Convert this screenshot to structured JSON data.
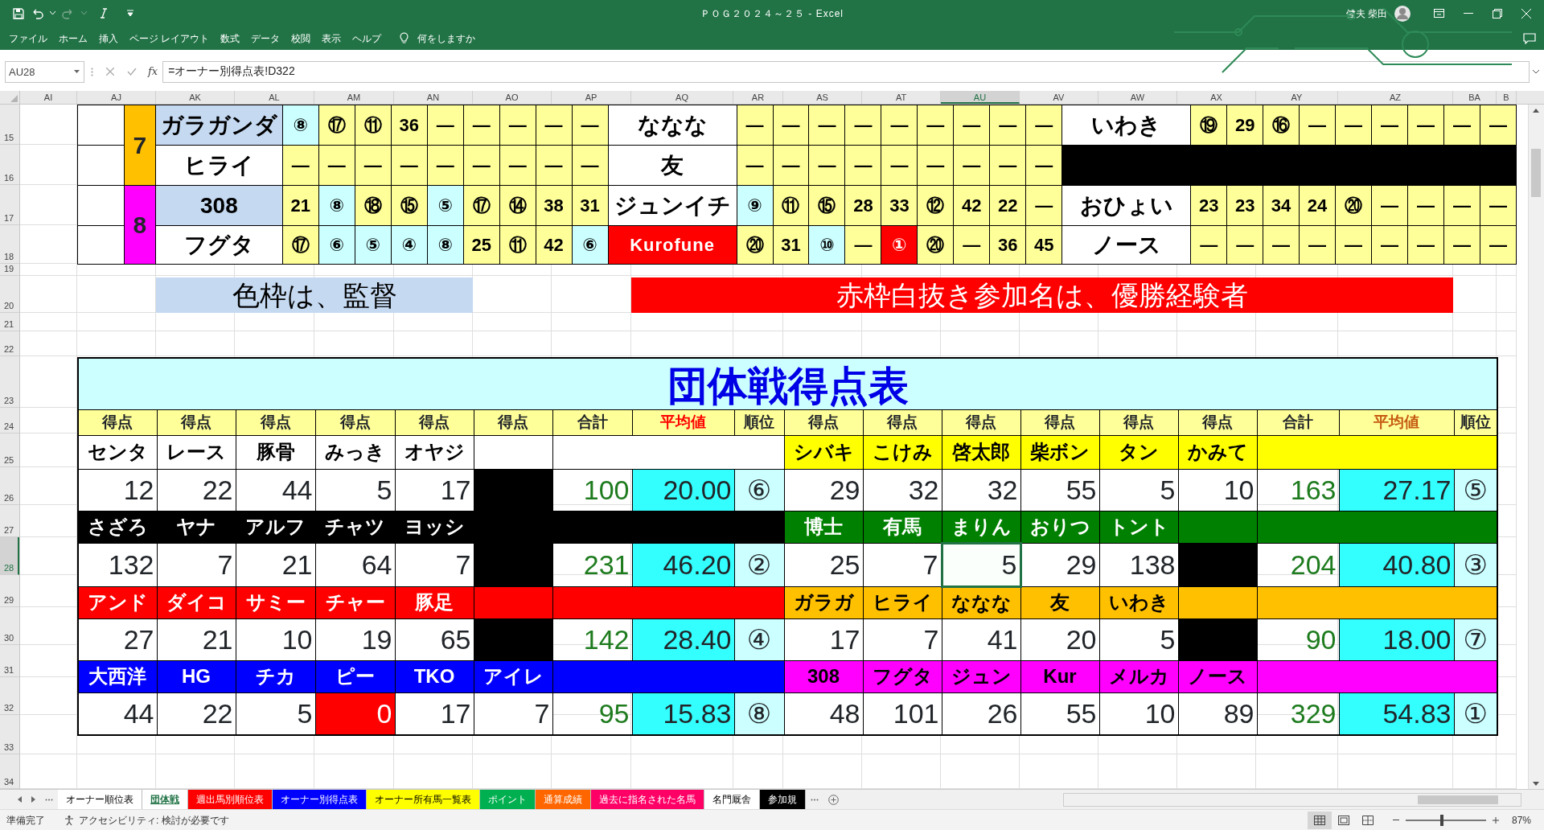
{
  "window": {
    "title": "ＰＯＧ２０２４～２５ - Excel",
    "user": "健夫 柴田"
  },
  "ribbon_tabs": [
    "ファイル",
    "ホーム",
    "挿入",
    "ページ レイアウト",
    "数式",
    "データ",
    "校閲",
    "表示",
    "ヘルプ"
  ],
  "tell_me": "何をしますか",
  "name_box": "AU28",
  "function_button": "fx",
  "formula": "=オーナー別得点表!D322",
  "columns": [
    {
      "label": "AI",
      "selected": false
    },
    {
      "label": "AJ",
      "selected": false
    },
    {
      "label": "AK",
      "selected": false
    },
    {
      "label": "AL",
      "selected": false
    },
    {
      "label": "AM",
      "selected": false
    },
    {
      "label": "AN",
      "selected": false
    },
    {
      "label": "AO",
      "selected": false
    },
    {
      "label": "AP",
      "selected": false
    },
    {
      "label": "AQ",
      "selected": false
    },
    {
      "label": "AR",
      "selected": false
    },
    {
      "label": "AS",
      "selected": false
    },
    {
      "label": "AT",
      "selected": false
    },
    {
      "label": "AU",
      "selected": true
    },
    {
      "label": "AV",
      "selected": false
    },
    {
      "label": "AW",
      "selected": false
    },
    {
      "label": "AX",
      "selected": false
    },
    {
      "label": "AY",
      "selected": false
    },
    {
      "label": "AZ",
      "selected": false
    },
    {
      "label": "BA",
      "selected": false
    },
    {
      "label": "B",
      "selected": false
    }
  ],
  "rows": [
    {
      "label": "15",
      "selected": false
    },
    {
      "label": "16",
      "selected": false
    },
    {
      "label": "17",
      "selected": false
    },
    {
      "label": "18",
      "selected": false
    },
    {
      "label": "19",
      "selected": false
    },
    {
      "label": "20",
      "selected": false
    },
    {
      "label": "21",
      "selected": false
    },
    {
      "label": "22",
      "selected": false
    },
    {
      "label": "23",
      "selected": false
    },
    {
      "label": "24",
      "selected": false
    },
    {
      "label": "25",
      "selected": false
    },
    {
      "label": "26",
      "selected": false
    },
    {
      "label": "27",
      "selected": false
    },
    {
      "label": "28",
      "selected": true
    },
    {
      "label": "29",
      "selected": false
    },
    {
      "label": "30",
      "selected": false
    },
    {
      "label": "31",
      "selected": false
    },
    {
      "label": "32",
      "selected": false
    },
    {
      "label": "33",
      "selected": false
    },
    {
      "label": "34",
      "selected": false
    }
  ],
  "roster": {
    "groups": [
      {
        "number": "7",
        "color": "#ffc000",
        "rows": [
          {
            "blocks": [
              {
                "kind": "entry",
                "name": "ガラガンダ",
                "manager": true,
                "champion": false,
                "cells": [
                  {
                    "text": "⑧",
                    "color": "#ccffff"
                  },
                  {
                    "text": "⑰"
                  },
                  {
                    "text": "⑪"
                  },
                  {
                    "text": "36"
                  },
                  {
                    "text": "—"
                  },
                  {
                    "text": "—"
                  },
                  {
                    "text": "—"
                  },
                  {
                    "text": "—"
                  },
                  {
                    "text": "—"
                  }
                ]
              },
              {
                "kind": "entry",
                "name": "ななな",
                "manager": false,
                "champion": false,
                "cells": [
                  {
                    "text": "—"
                  },
                  {
                    "text": "—"
                  },
                  {
                    "text": "—"
                  },
                  {
                    "text": "—"
                  },
                  {
                    "text": "—"
                  },
                  {
                    "text": "—"
                  },
                  {
                    "text": "—"
                  },
                  {
                    "text": "—"
                  },
                  {
                    "text": "—"
                  }
                ]
              },
              {
                "kind": "entry",
                "name": "いわき",
                "manager": false,
                "champion": false,
                "cells": [
                  {
                    "text": "⑲"
                  },
                  {
                    "text": "29"
                  },
                  {
                    "text": "⑯"
                  },
                  {
                    "text": "—"
                  },
                  {
                    "text": "—"
                  },
                  {
                    "text": "—"
                  },
                  {
                    "text": "—"
                  },
                  {
                    "text": "—"
                  },
                  {
                    "text": "—"
                  }
                ]
              }
            ]
          },
          {
            "blocks": [
              {
                "kind": "entry",
                "name": "ヒライ",
                "manager": false,
                "champion": false,
                "cells": [
                  {
                    "text": "—"
                  },
                  {
                    "text": "—"
                  },
                  {
                    "text": "—"
                  },
                  {
                    "text": "—"
                  },
                  {
                    "text": "—"
                  },
                  {
                    "text": "—"
                  },
                  {
                    "text": "—"
                  },
                  {
                    "text": "—"
                  },
                  {
                    "text": "—"
                  }
                ]
              },
              {
                "kind": "entry",
                "name": "友",
                "manager": false,
                "champion": false,
                "cells": [
                  {
                    "text": "—"
                  },
                  {
                    "text": "—"
                  },
                  {
                    "text": "—"
                  },
                  {
                    "text": "—"
                  },
                  {
                    "text": "—"
                  },
                  {
                    "text": "—"
                  },
                  {
                    "text": "—"
                  },
                  {
                    "text": "—"
                  },
                  {
                    "text": "—"
                  }
                ]
              },
              {
                "kind": "blank"
              }
            ]
          }
        ]
      },
      {
        "number": "8",
        "color": "#ff00ff",
        "rows": [
          {
            "blocks": [
              {
                "kind": "entry",
                "name": "308",
                "manager": true,
                "champion": false,
                "cells": [
                  {
                    "text": "21"
                  },
                  {
                    "text": "⑧",
                    "color": "#ccffff"
                  },
                  {
                    "text": "⑱"
                  },
                  {
                    "text": "⑮"
                  },
                  {
                    "text": "⑤",
                    "color": "#ccffff"
                  },
                  {
                    "text": "⑰"
                  },
                  {
                    "text": "⑭"
                  },
                  {
                    "text": "38"
                  },
                  {
                    "text": "31"
                  }
                ]
              },
              {
                "kind": "entry",
                "name": "ジュンイチ",
                "manager": false,
                "champion": false,
                "cells": [
                  {
                    "text": "⑨",
                    "color": "#ccffff"
                  },
                  {
                    "text": "⑪"
                  },
                  {
                    "text": "⑮"
                  },
                  {
                    "text": "28"
                  },
                  {
                    "text": "33"
                  },
                  {
                    "text": "⑫"
                  },
                  {
                    "text": "42"
                  },
                  {
                    "text": "22"
                  },
                  {
                    "text": "—"
                  }
                ]
              },
              {
                "kind": "entry",
                "name": "おひょい",
                "manager": false,
                "champion": false,
                "cells": [
                  {
                    "text": "23"
                  },
                  {
                    "text": "23"
                  },
                  {
                    "text": "34"
                  },
                  {
                    "text": "24"
                  },
                  {
                    "text": "⑳"
                  },
                  {
                    "text": "—"
                  },
                  {
                    "text": "—"
                  },
                  {
                    "text": "—"
                  },
                  {
                    "text": "—"
                  }
                ]
              }
            ]
          },
          {
            "blocks": [
              {
                "kind": "entry",
                "name": "フグタ",
                "manager": false,
                "champion": false,
                "cells": [
                  {
                    "text": "⑰"
                  },
                  {
                    "text": "⑥",
                    "color": "#ccffff"
                  },
                  {
                    "text": "⑤",
                    "color": "#ccffff"
                  },
                  {
                    "text": "④",
                    "color": "#ccffff"
                  },
                  {
                    "text": "⑧",
                    "color": "#ccffff"
                  },
                  {
                    "text": "25"
                  },
                  {
                    "text": "⑪"
                  },
                  {
                    "text": "42"
                  },
                  {
                    "text": "⑥",
                    "color": "#ccffff"
                  }
                ]
              },
              {
                "kind": "entry",
                "name": "Kurofune",
                "manager": false,
                "champion": true,
                "cells": [
                  {
                    "text": "⑳"
                  },
                  {
                    "text": "31"
                  },
                  {
                    "text": "⑩",
                    "color": "#ccffff"
                  },
                  {
                    "text": "—"
                  },
                  {
                    "text": "①",
                    "color": "#ff0000"
                  },
                  {
                    "text": "⑳"
                  },
                  {
                    "text": "—"
                  },
                  {
                    "text": "36"
                  },
                  {
                    "text": "45"
                  }
                ]
              },
              {
                "kind": "entry",
                "name": "ノース",
                "manager": false,
                "champion": false,
                "cells": [
                  {
                    "text": "—"
                  },
                  {
                    "text": "—"
                  },
                  {
                    "text": "—"
                  },
                  {
                    "text": "—"
                  },
                  {
                    "text": "—"
                  },
                  {
                    "text": "—"
                  },
                  {
                    "text": "—"
                  },
                  {
                    "text": "—"
                  },
                  {
                    "text": "—"
                  }
                ]
              }
            ]
          }
        ]
      }
    ]
  },
  "legend": [
    {
      "text": "色枠は、監督",
      "color": "#c5d9f1"
    },
    {
      "text": "赤枠白抜き参加名は、優勝経験者",
      "color": "#ff0000"
    }
  ],
  "score_table": {
    "title": "団体戦得点表",
    "sides": [
      {
        "headers": [
          "得点",
          "得点",
          "得点",
          "得点",
          "得点",
          "得点",
          "合計",
          "平均値",
          "順位"
        ],
        "teams": [
          {
            "color": "#ffffff",
            "names": [
              "センタ",
              "レース",
              "豚骨",
              "みっき",
              "オヤジ"
            ],
            "scores": [
              {
                "kind": "score",
                "text": "12",
                "selected": false
              },
              {
                "kind": "score",
                "text": "22",
                "selected": false
              },
              {
                "kind": "score",
                "text": "44",
                "selected": false
              },
              {
                "kind": "score",
                "text": "5",
                "selected": false
              },
              {
                "kind": "score",
                "text": "17",
                "selected": false
              },
              {
                "kind": "blank",
                "selected": false
              }
            ],
            "total": "100",
            "average": "20.00",
            "rank": "⑥"
          },
          {
            "color": "#000000",
            "names": [
              "さざろ",
              "ヤナ",
              "アルフ",
              "チャツ",
              "ヨッシ"
            ],
            "scores": [
              {
                "kind": "score",
                "text": "132",
                "selected": false
              },
              {
                "kind": "score",
                "text": "7",
                "selected": false
              },
              {
                "kind": "score",
                "text": "21",
                "selected": false
              },
              {
                "kind": "score",
                "text": "64",
                "selected": false
              },
              {
                "kind": "score",
                "text": "7",
                "selected": false
              },
              {
                "kind": "blank",
                "selected": false
              }
            ],
            "total": "231",
            "average": "46.20",
            "rank": "②"
          },
          {
            "color": "#ff0000",
            "names": [
              "アンド",
              "ダイコ",
              "サミー",
              "チャー",
              "豚足"
            ],
            "scores": [
              {
                "kind": "score",
                "text": "27",
                "selected": false
              },
              {
                "kind": "score",
                "text": "21",
                "selected": false
              },
              {
                "kind": "score",
                "text": "10",
                "selected": false
              },
              {
                "kind": "score",
                "text": "19",
                "selected": false
              },
              {
                "kind": "score",
                "text": "65",
                "selected": false
              },
              {
                "kind": "blank",
                "selected": false
              }
            ],
            "total": "142",
            "average": "28.40",
            "rank": "④"
          },
          {
            "color": "#0000ff",
            "names": [
              "大西洋",
              "HG",
              "チカ",
              "ピー",
              "TKO",
              "アイレ"
            ],
            "scores": [
              {
                "kind": "score",
                "text": "44",
                "selected": false
              },
              {
                "kind": "score",
                "text": "22",
                "selected": false
              },
              {
                "kind": "score",
                "text": "5",
                "selected": false
              },
              {
                "kind": "flagged",
                "text": "0",
                "selected": false
              },
              {
                "kind": "score",
                "text": "17",
                "selected": false
              },
              {
                "kind": "score",
                "text": "7",
                "selected": false
              }
            ],
            "total": "95",
            "average": "15.83",
            "rank": "⑧"
          }
        ]
      },
      {
        "headers": [
          "得点",
          "得点",
          "得点",
          "得点",
          "得点",
          "得点",
          "合計",
          "平均値",
          "順位"
        ],
        "teams": [
          {
            "color": "#ffff00",
            "names": [
              "シバキ",
              "こけみ",
              "啓太郎",
              "柴ボン",
              "タン",
              "かみて"
            ],
            "scores": [
              {
                "kind": "score",
                "text": "29",
                "selected": false
              },
              {
                "kind": "score",
                "text": "32",
                "selected": false
              },
              {
                "kind": "score",
                "text": "32",
                "selected": false
              },
              {
                "kind": "score",
                "text": "55",
                "selected": false
              },
              {
                "kind": "score",
                "text": "5",
                "selected": false
              },
              {
                "kind": "score",
                "text": "10",
                "selected": false
              }
            ],
            "total": "163",
            "average": "27.17",
            "rank": "⑤"
          },
          {
            "color": "#008000",
            "names": [
              "博士",
              "有馬",
              "まりん",
              "おりつ",
              "トント"
            ],
            "scores": [
              {
                "kind": "score",
                "text": "25",
                "selected": false
              },
              {
                "kind": "score",
                "text": "7",
                "selected": false
              },
              {
                "kind": "score",
                "text": "5",
                "selected": true
              },
              {
                "kind": "score",
                "text": "29",
                "selected": false
              },
              {
                "kind": "score",
                "text": "138",
                "selected": false
              },
              {
                "kind": "blank",
                "selected": false
              }
            ],
            "total": "204",
            "average": "40.80",
            "rank": "③"
          },
          {
            "color": "#ffc000",
            "names": [
              "ガラガ",
              "ヒライ",
              "ななな",
              "友",
              "いわき"
            ],
            "scores": [
              {
                "kind": "score",
                "text": "17",
                "selected": false
              },
              {
                "kind": "score",
                "text": "7",
                "selected": false
              },
              {
                "kind": "score",
                "text": "41",
                "selected": false
              },
              {
                "kind": "score",
                "text": "20",
                "selected": false
              },
              {
                "kind": "score",
                "text": "5",
                "selected": false
              },
              {
                "kind": "blank",
                "selected": false
              }
            ],
            "total": "90",
            "average": "18.00",
            "rank": "⑦"
          },
          {
            "color": "#ff00ff",
            "names": [
              "308",
              "フグタ",
              "ジュン",
              "Kur",
              "メルカ",
              "ノース"
            ],
            "scores": [
              {
                "kind": "score",
                "text": "48",
                "selected": false
              },
              {
                "kind": "score",
                "text": "101",
                "selected": false
              },
              {
                "kind": "score",
                "text": "26",
                "selected": false
              },
              {
                "kind": "score",
                "text": "55",
                "selected": false
              },
              {
                "kind": "score",
                "text": "10",
                "selected": false
              },
              {
                "kind": "score",
                "text": "89",
                "selected": false
              }
            ],
            "total": "329",
            "average": "54.83",
            "rank": "①"
          }
        ]
      }
    ]
  },
  "sheet_tabs": [
    {
      "label": "オーナー順位表",
      "color": "#ffffff",
      "selected": false
    },
    {
      "label": "団体戦",
      "selected": true
    },
    {
      "label": "週出馬別順位表",
      "color": "#ff0000",
      "selected": false
    },
    {
      "label": "オーナー別得点表",
      "color": "#0000ff",
      "selected": false
    },
    {
      "label": "オーナー所有馬一覧表",
      "color": "#ffff00",
      "selected": false
    },
    {
      "label": "ポイント",
      "color": "#00b050",
      "selected": false
    },
    {
      "label": "通算成績",
      "color": "#ff6600",
      "selected": false
    },
    {
      "label": "過去に指名された名馬",
      "color": "#ff0066",
      "selected": false
    },
    {
      "label": "名門厩舎",
      "color": "#ffffff",
      "selected": false
    },
    {
      "label": "参加規",
      "color": "#000000",
      "selected": false
    }
  ],
  "status": "準備完了",
  "accessibility": "アクセシビリティ: 検討が必要です",
  "view_buttons": [
    {
      "kind": "normal",
      "selected": true
    },
    {
      "kind": "page_layout",
      "selected": false
    },
    {
      "kind": "page_break",
      "selected": false
    }
  ],
  "zoom": {
    "level": 0.45,
    "reading": "87%"
  }
}
